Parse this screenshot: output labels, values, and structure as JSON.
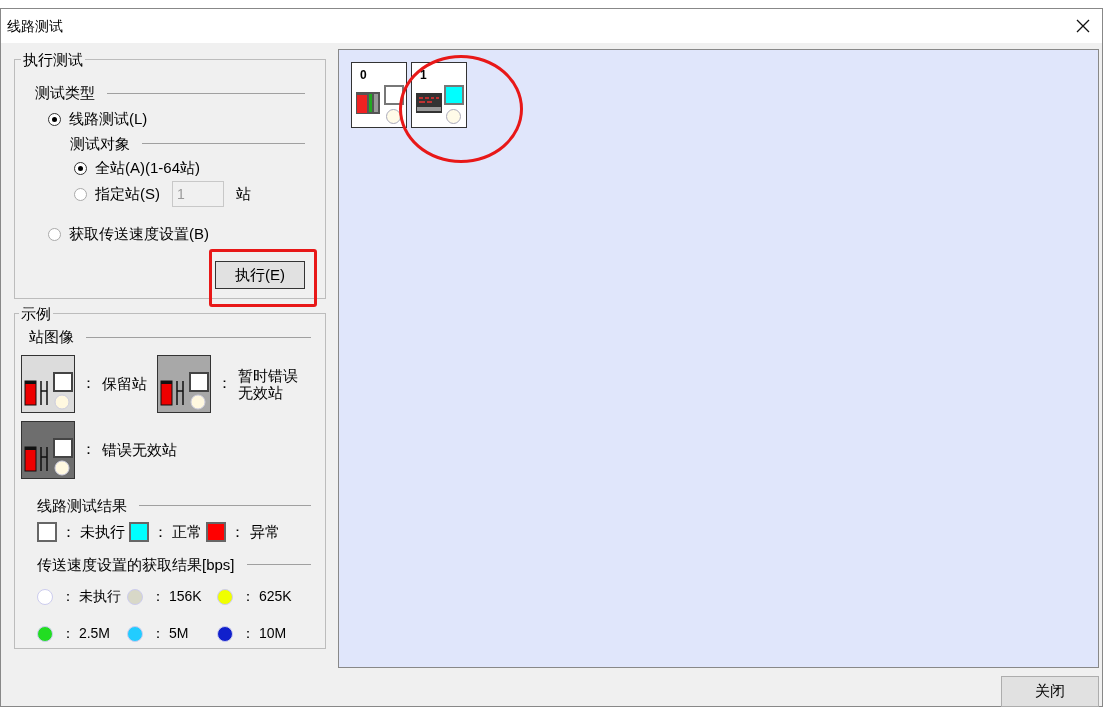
{
  "window": {
    "title": "线路测试"
  },
  "execute_group": {
    "title": "执行测试",
    "test_type": {
      "title": "测试类型",
      "options": [
        {
          "label": "线路测试(L)",
          "selected": true
        },
        {
          "label": "获取传送速度设置(B)",
          "selected": false
        }
      ]
    },
    "test_target": {
      "title": "测试对象",
      "options": [
        {
          "label": "全站(A)(1-64站)",
          "selected": true
        },
        {
          "label": "指定站(S)",
          "selected": false
        }
      ],
      "station_field": {
        "value": "1",
        "disabled": true
      },
      "station_unit": "站"
    },
    "execute_button": "执行(E)"
  },
  "legend": {
    "title": "示例",
    "separator": "：",
    "station_images": {
      "title": "站图像",
      "items": [
        {
          "lines": [
            "保留站"
          ],
          "kind": "reserved"
        },
        {
          "lines": [
            "暂时错误",
            "无效站"
          ],
          "kind": "temp_error"
        },
        {
          "lines": [
            "错误无效站"
          ],
          "kind": "error"
        }
      ]
    },
    "line_result": {
      "title": "线路测试结果",
      "items": [
        {
          "label": "未执行",
          "color": "#ffffff"
        },
        {
          "label": "正常",
          "color": "#00ffff"
        },
        {
          "label": "异常",
          "color": "#ff0000"
        }
      ]
    },
    "speed_result": {
      "title": "传送速度设置的获取结果[bps]",
      "items": [
        {
          "label": "未执行",
          "color": "#ffffff"
        },
        {
          "label": "156K",
          "color": "#d8d8c8"
        },
        {
          "label": "625K",
          "color": "#f0ff00"
        },
        {
          "label": "2.5M",
          "color": "#22dd22"
        },
        {
          "label": "5M",
          "color": "#22ccff"
        },
        {
          "label": "10M",
          "color": "#1020cc"
        }
      ]
    }
  },
  "stations": [
    {
      "number": "0",
      "kind": "cpu",
      "color": "#ffffff"
    },
    {
      "number": "1",
      "kind": "io",
      "color": "#00ffff"
    }
  ],
  "close_button": "关闭"
}
